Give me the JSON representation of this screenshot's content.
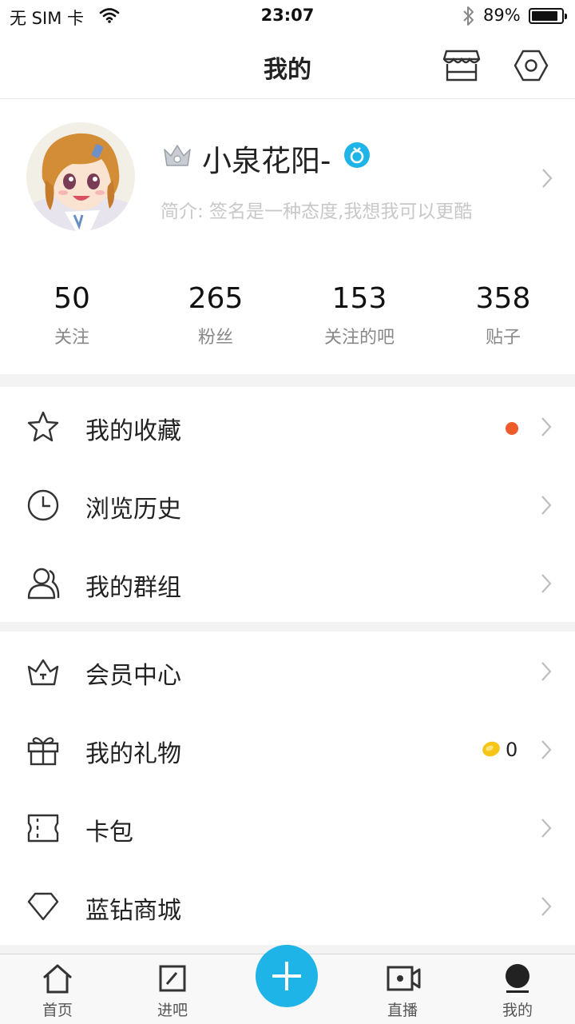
{
  "status_bar": {
    "carrier": "无 SIM 卡",
    "time": "23:07",
    "battery_pct": "89%",
    "battery_level": 0.89
  },
  "nav": {
    "title": "我的",
    "store_icon": "store-icon",
    "settings_icon": "settings-hexagon-icon"
  },
  "profile": {
    "username": "小泉花阳-",
    "bio": "简介: 签名是一种态度,我想我可以更酷",
    "crown_icon": "crown-badge-icon",
    "verify_icon": "verified-badge-icon"
  },
  "stats": [
    {
      "value": "50",
      "label": "关注"
    },
    {
      "value": "265",
      "label": "粉丝"
    },
    {
      "value": "153",
      "label": "关注的吧"
    },
    {
      "value": "358",
      "label": "贴子"
    }
  ],
  "menu": {
    "favorites": "我的收藏",
    "history": "浏览历史",
    "groups": "我的群组",
    "vip": "会员中心",
    "gifts": "我的礼物",
    "gift_count": "0",
    "card_wallet": "卡包",
    "diamond_mall": "蓝钻商城"
  },
  "tabs": {
    "home": "首页",
    "enter_bar": "进吧",
    "live": "直播",
    "mine": "我的"
  },
  "colors": {
    "accent": "#1fb4e8",
    "notice_dot": "#f05a28",
    "coin": "#f5c518"
  }
}
